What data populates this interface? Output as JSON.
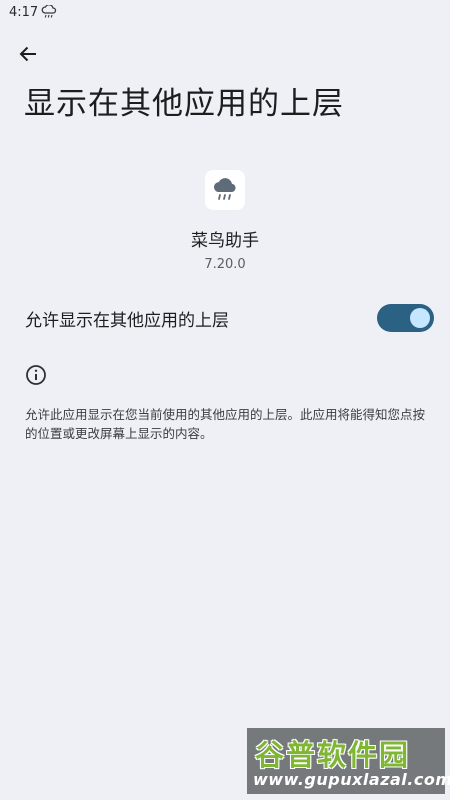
{
  "status_bar": {
    "time": "4:17",
    "weather_icon": "cloud-rain-icon"
  },
  "toolbar": {
    "back_icon": "arrow-left-icon"
  },
  "page": {
    "title": "显示在其他应用的上层"
  },
  "app": {
    "icon": "cloud-rain-icon",
    "name": "菜鸟助手",
    "version": "7.20.0"
  },
  "permission": {
    "label": "允许显示在其他应用的上层",
    "enabled": true,
    "track_color": "#2b6183",
    "thumb_color": "#c5e6ff"
  },
  "info": {
    "icon": "info-icon",
    "text": "允许此应用显示在您当前使用的其他应用的上层。此应用将能得知您点按的位置或更改屏幕上显示的内容。"
  },
  "watermark": {
    "title": "谷普软件园",
    "url": "www.gupuxlazal.com"
  },
  "colors": {
    "background": "#eef0f5",
    "text_primary": "#1d1d20"
  }
}
